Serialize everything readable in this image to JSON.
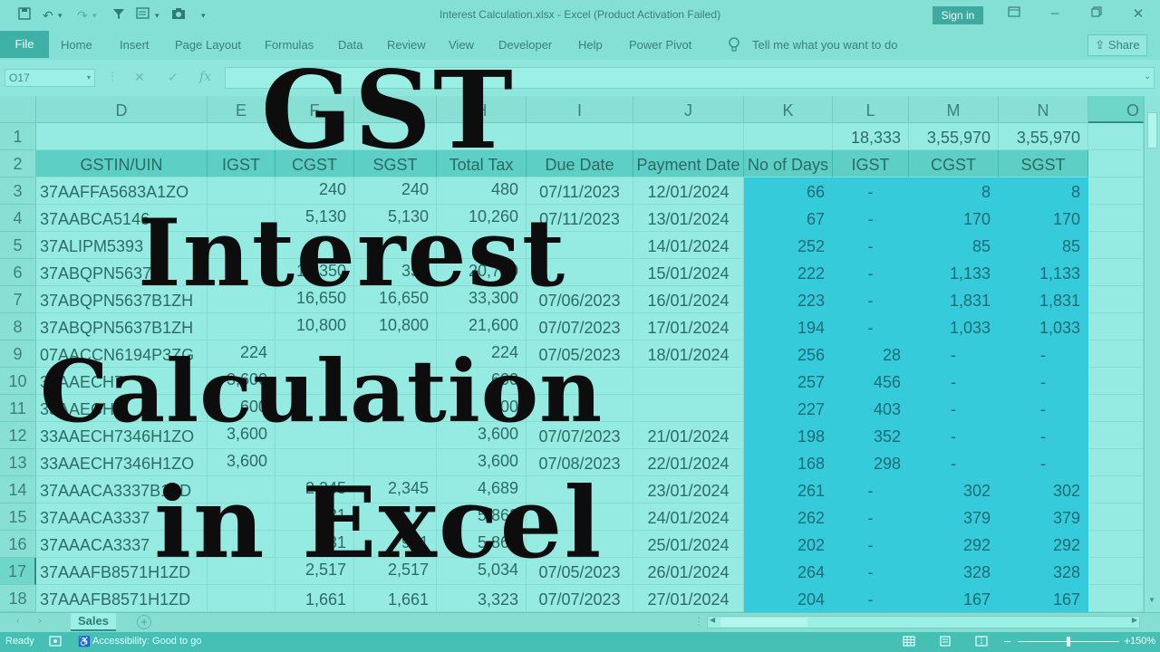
{
  "window": {
    "title": "Interest Calculation.xlsx  -  Excel (Product Activation Failed)",
    "sign_in": "Sign in"
  },
  "ribbon": {
    "file": "File",
    "tabs": [
      "Home",
      "Insert",
      "Page Layout",
      "Formulas",
      "Data",
      "Review",
      "View",
      "Developer",
      "Help",
      "Power Pivot"
    ],
    "tell_me": "Tell me what you want to do",
    "share": "Share"
  },
  "formula_bar": {
    "name_box": "O17",
    "cancel": "✕",
    "enter": "✓",
    "fx": "fx",
    "content": ""
  },
  "grid": {
    "columns": [
      "D",
      "E",
      "F",
      "G",
      "H",
      "I",
      "J",
      "K",
      "L",
      "M",
      "N",
      "O"
    ],
    "row_numbers": [
      "1",
      "2",
      "3",
      "4",
      "5",
      "6",
      "7",
      "8",
      "9",
      "10",
      "11",
      "12",
      "13",
      "14",
      "15",
      "16",
      "17",
      "18"
    ],
    "totals_row": {
      "L": "18,333",
      "M": "3,55,970",
      "N": "3,55,970"
    },
    "headers": [
      "GSTIN/UIN",
      "IGST",
      "CGST",
      "SGST",
      "Total Tax",
      "Due Date",
      "Payment Date",
      "No of Days",
      "IGST",
      "CGST",
      "SGST"
    ],
    "rows": [
      [
        "37AAFFA5683A1ZO",
        "",
        "240",
        "240",
        "480",
        "07/11/2023",
        "12/01/2024",
        "66",
        "-",
        "8",
        "8"
      ],
      [
        "37AABCA5146",
        "",
        "5,130",
        "5,130",
        "10,260",
        "07/11/2023",
        "13/01/2024",
        "67",
        "-",
        "170",
        "170"
      ],
      [
        "37ALIPM5393",
        "",
        "",
        "",
        "",
        "",
        "14/01/2024",
        "252",
        "-",
        "85",
        "85"
      ],
      [
        "37ABQPN5637",
        "",
        "10,350",
        "350",
        "20,700",
        "",
        "15/01/2024",
        "222",
        "-",
        "1,133",
        "1,133"
      ],
      [
        "37ABQPN5637B1ZH",
        "",
        "16,650",
        "16,650",
        "33,300",
        "07/06/2023",
        "16/01/2024",
        "223",
        "-",
        "1,831",
        "1,831"
      ],
      [
        "37ABQPN5637B1ZH",
        "",
        "10,800",
        "10,800",
        "21,600",
        "07/07/2023",
        "17/01/2024",
        "194",
        "-",
        "1,033",
        "1,033"
      ],
      [
        "07AACCN6194P3ZG",
        "224",
        "",
        "",
        "224",
        "07/05/2023",
        "18/01/2024",
        "256",
        "28",
        "-",
        "-"
      ],
      [
        "33AAECH7",
        "3,600",
        "",
        "",
        "600",
        "",
        "",
        "257",
        "456",
        "-",
        "-"
      ],
      [
        "33AAECH7",
        "600",
        "",
        "",
        "600",
        "",
        "",
        "227",
        "403",
        "-",
        "-"
      ],
      [
        "33AAECH7346H1ZO",
        "3,600",
        "",
        "",
        "3,600",
        "07/07/2023",
        "21/01/2024",
        "198",
        "352",
        "-",
        "-"
      ],
      [
        "33AAECH7346H1ZO",
        "3,600",
        "",
        "",
        "3,600",
        "07/08/2023",
        "22/01/2024",
        "168",
        "298",
        "-",
        "-"
      ],
      [
        "37AAACA3337B1ZD",
        "",
        "2,345",
        "2,345",
        "4,689",
        "",
        "23/01/2024",
        "261",
        "-",
        "302",
        "302"
      ],
      [
        "37AAACA3337",
        "",
        "931",
        "",
        "5,862",
        "",
        "24/01/2024",
        "262",
        "-",
        "379",
        "379"
      ],
      [
        "37AAACA3337",
        "",
        "931",
        "931",
        "5,862",
        "",
        "25/01/2024",
        "202",
        "-",
        "292",
        "292"
      ],
      [
        "37AAAFB8571H1ZD",
        "",
        "2,517",
        "2,517",
        "5,034",
        "07/05/2023",
        "26/01/2024",
        "264",
        "-",
        "328",
        "328"
      ],
      [
        "37AAAFB8571H1ZD",
        "",
        "1,661",
        "1,661",
        "3,323",
        "07/07/2023",
        "27/01/2024",
        "204",
        "-",
        "167",
        "167"
      ]
    ]
  },
  "overlay": {
    "line1": "GST",
    "line2": "Interest",
    "line3": "Calculation",
    "line4": "in Excel"
  },
  "sheets": {
    "active": "Sales"
  },
  "status": {
    "ready": "Ready",
    "accessibility": "Accessibility: Good to go",
    "zoom": "150%"
  },
  "colors": {
    "accent": "#3fb0a6",
    "highlight": "#35cbdb",
    "header_fill": "#5dcfc4"
  }
}
